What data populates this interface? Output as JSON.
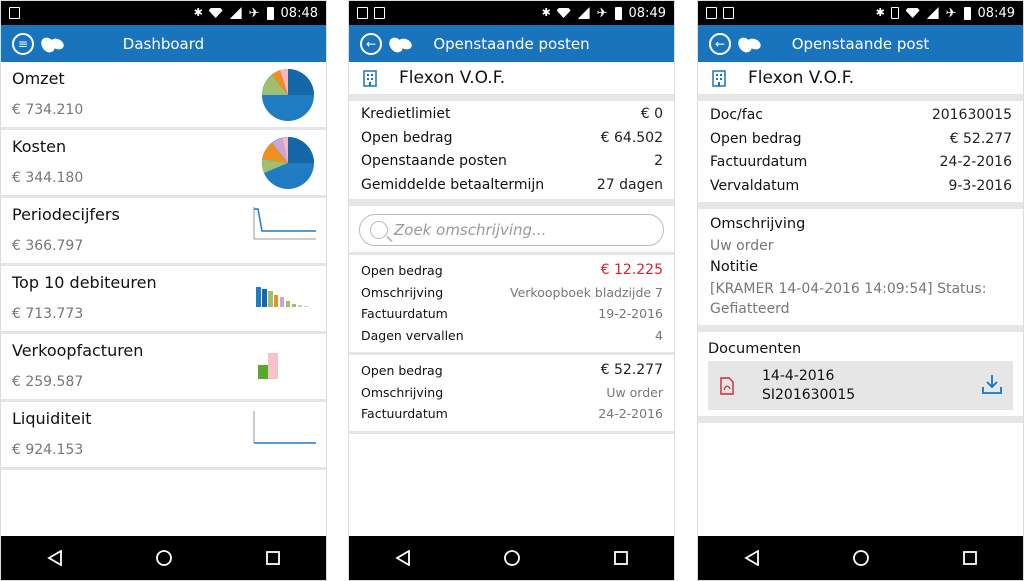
{
  "status": {
    "time1": "08:48",
    "time2": "08:49",
    "time3": "08:49"
  },
  "colors": {
    "appbar": "#1a74bc",
    "red": "#d9232e",
    "accent": "#1a74bc"
  },
  "screen1": {
    "title": "Dashboard",
    "items": [
      {
        "title": "Omzet",
        "value": "€ 734.210",
        "graph": "pie"
      },
      {
        "title": "Kosten",
        "value": "€ 344.180",
        "graph": "pie"
      },
      {
        "title": "Periodecijfers",
        "value": "€ 366.797",
        "graph": "line"
      },
      {
        "title": "Top 10 debiteuren",
        "value": "€ 713.773",
        "graph": "bars"
      },
      {
        "title": "Verkoopfacturen",
        "value": "€ 259.587",
        "graph": "bars2"
      },
      {
        "title": "Liquiditeit",
        "value": "€ 924.153",
        "graph": "flat"
      }
    ]
  },
  "screen2": {
    "title": "Openstaande posten",
    "company": "Flexon V.O.F.",
    "summary": [
      {
        "k": "Kredietlimiet",
        "v": "€ 0"
      },
      {
        "k": "Open bedrag",
        "v": "€ 64.502"
      },
      {
        "k": "Openstaande posten",
        "v": "2"
      },
      {
        "k": "Gemiddelde betaaltermijn",
        "v": "27 dagen"
      }
    ],
    "search_placeholder": "Zoek omschrijving...",
    "posts": [
      {
        "rows": [
          {
            "k": "Open bedrag",
            "v": "€ 12.225"
          },
          {
            "k": "Omschrijving",
            "v": "Verkoopboek bladzijde 7"
          },
          {
            "k": "Factuurdatum",
            "v": "19-2-2016"
          },
          {
            "k": "Dagen vervallen",
            "v": "4"
          }
        ]
      },
      {
        "rows": [
          {
            "k": "Open bedrag",
            "v": "€ 52.277"
          },
          {
            "k": "Omschrijving",
            "v": "Uw order"
          },
          {
            "k": "Factuurdatum",
            "v": "24-2-2016"
          }
        ]
      }
    ]
  },
  "screen3": {
    "title": "Openstaande post",
    "company": "Flexon V.O.F.",
    "details": [
      {
        "k": "Doc/fac",
        "v": "201630015"
      },
      {
        "k": "Open bedrag",
        "v": "€ 52.277"
      },
      {
        "k": "Factuurdatum",
        "v": "24-2-2016"
      },
      {
        "k": "Vervaldatum",
        "v": "9-3-2016"
      }
    ],
    "omschrijving_label": "Omschrijving",
    "omschrijving_text": "Uw order",
    "notitie_label": "Notitie",
    "notitie_text": "[KRAMER 14-04-2016 14:09:54] Status: Gefiatteerd",
    "documenten_label": "Documenten",
    "document": {
      "date": "14-4-2016",
      "name": "SI201630015"
    }
  }
}
